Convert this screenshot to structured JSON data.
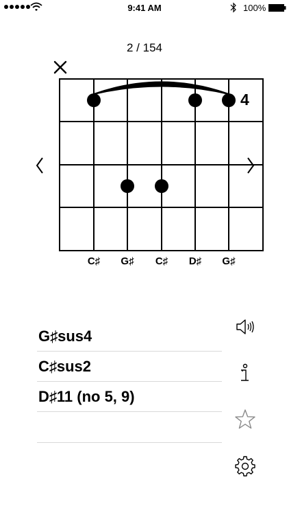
{
  "status_bar": {
    "time": "9:41 AM",
    "battery": "100%",
    "signal_icon": "signal-dots-icon",
    "wifi_icon": "wifi-icon",
    "bluetooth_icon": "bluetooth-icon",
    "battery_icon": "battery-icon"
  },
  "viewer": {
    "counter": "2 / 154",
    "fret_position": "4",
    "close_icon": "close-icon",
    "prev_icon": "chevron-left-icon",
    "next_icon": "chevron-right-icon"
  },
  "string_notes": [
    "C♯",
    "G♯",
    "C♯",
    "D♯",
    "G♯"
  ],
  "chords": [
    "G♯sus4",
    "C♯sus2",
    "D♯11 (no 5, 9)",
    ""
  ],
  "side_icons": [
    "speaker-icon",
    "info-icon",
    "star-icon",
    "gear-icon"
  ]
}
